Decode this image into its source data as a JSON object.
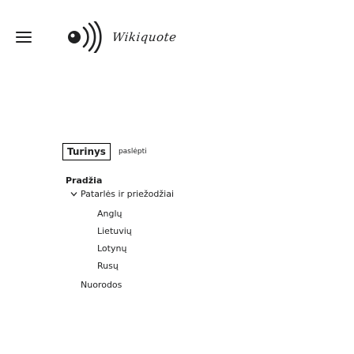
{
  "header": {
    "menu_icon": "hamburger-menu-icon",
    "logo_icon": "radio-waves-logo-icon",
    "wordmark": "Wikiquote"
  },
  "toc_tabs": {
    "active_label": "Turinys",
    "hide_label": "paslėpti"
  },
  "toc": {
    "items": [
      {
        "label": "Pradžia"
      },
      {
        "label": "Patarlės ir priežodžiai",
        "icon": "chevron-down-icon"
      },
      {
        "label": "Anglų"
      },
      {
        "label": "Lietuvių"
      },
      {
        "label": "Lotynų"
      },
      {
        "label": "Rusų"
      },
      {
        "label": "Nuorodos"
      }
    ]
  },
  "colors": {
    "text": "#202122",
    "link": "#3366cc",
    "border": "#000000",
    "background": "#ffffff"
  }
}
